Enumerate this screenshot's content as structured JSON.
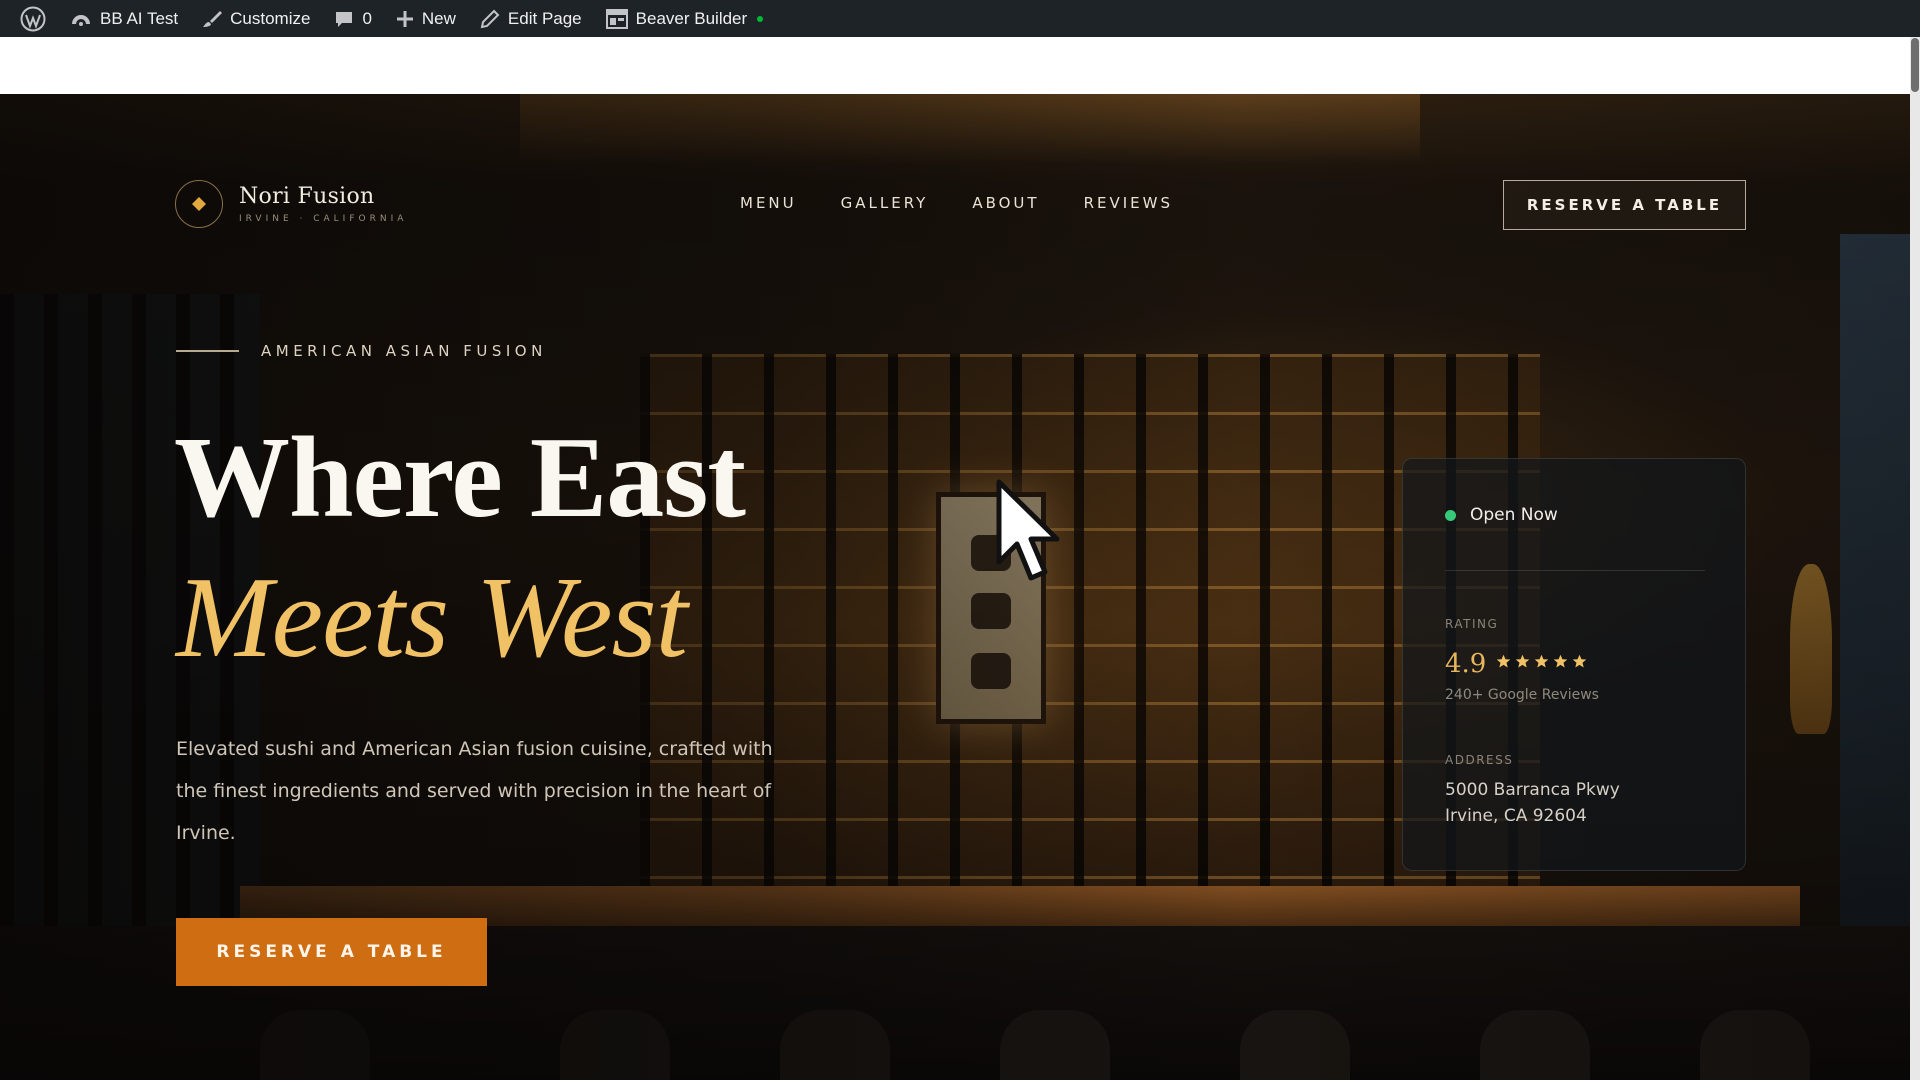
{
  "adminbar": {
    "site_name": "BB AI Test",
    "customize": "Customize",
    "comments_count": "0",
    "new": "New",
    "edit_page": "Edit Page",
    "builder": "Beaver Builder"
  },
  "header": {
    "logo_name": "Nori Fusion",
    "logo_sub": "IRVINE · CALIFORNIA",
    "nav": [
      "MENU",
      "GALLERY",
      "ABOUT",
      "REVIEWS"
    ],
    "cta": "RESERVE A TABLE"
  },
  "hero": {
    "eyebrow": "AMERICAN ASIAN FUSION",
    "headline_1": "Where East",
    "headline_2": "Meets West",
    "description": "Elevated sushi and American Asian fusion cuisine, crafted with the finest ingredients and served with precision in the heart of Irvine.",
    "cta": "RESERVE A TABLE"
  },
  "card": {
    "status": "Open Now",
    "rating_label": "RATING",
    "rating_value": "4.9",
    "stars": 5,
    "rating_count": "240+ Google Reviews",
    "address_label": "ADDRESS",
    "address_line_1": "5000 Barranca Pkwy",
    "address_line_2": "Irvine, CA 92604"
  },
  "colors": {
    "accent_gold": "#f1c265",
    "cta_orange": "#cf6d12",
    "status_green": "#37c979",
    "adminbar_bg": "#1d2327"
  },
  "icons": {
    "wp_logo": "wordpress-icon",
    "customize": "brush-icon",
    "comments": "comment-icon",
    "new": "plus-icon",
    "edit": "pencil-icon",
    "builder": "builder-grid-icon",
    "logo": "diamond-icon",
    "star": "star-icon",
    "cursor": "mouse-pointer-icon"
  }
}
